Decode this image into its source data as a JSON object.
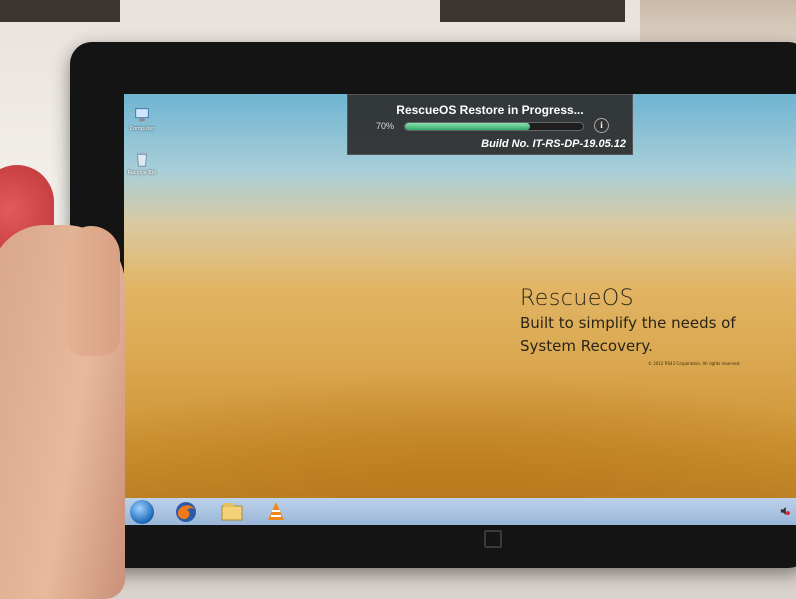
{
  "desktop": {
    "icons": [
      {
        "label": "Computer",
        "icon": "computer-icon"
      },
      {
        "label": "Recycle Bin",
        "icon": "recycle-bin-icon"
      }
    ]
  },
  "restore_panel": {
    "title": "RescueOS Restore in Progress...",
    "percent_label": "70%",
    "progress": 0.7,
    "build": "Build No. IT-RS-DP-19.05.12",
    "info_glyph": "i"
  },
  "wallpaper": {
    "product": "RescueOS",
    "tagline_line1": "Built to simplify the needs of",
    "tagline_line2": "System Recovery.",
    "copyright": "© 2012 RS43 Corporation. All rights reserved."
  },
  "taskbar": {
    "items": [
      "start-orb-icon",
      "firefox-icon",
      "file-explorer-icon",
      "vlc-icon"
    ],
    "tray": "volume-muted-icon"
  },
  "colors": {
    "taskbar": "#a9c4e2",
    "progress_fill": "#2fa86a",
    "panel_bg": "#2d2d2d"
  }
}
